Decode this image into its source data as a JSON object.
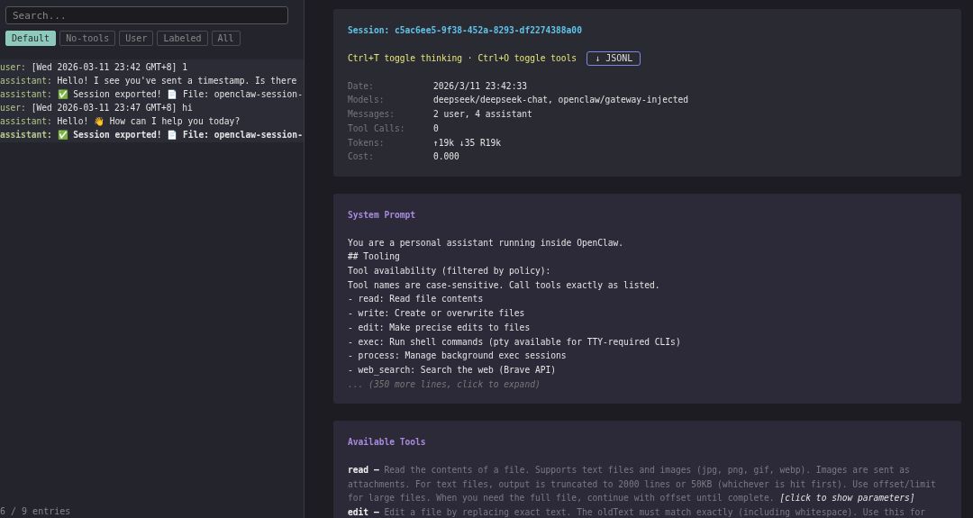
{
  "sidebar": {
    "search": {
      "placeholder": "Search..."
    },
    "filters": [
      {
        "label": "Default",
        "selected": true
      },
      {
        "label": "No-tools",
        "selected": false
      },
      {
        "label": "User",
        "selected": false
      },
      {
        "label": "Labeled",
        "selected": false
      },
      {
        "label": "All",
        "selected": false
      }
    ],
    "entries": [
      {
        "role": "user:",
        "text": "[Wed 2026-03-11 23:42 GMT+8] 1",
        "bold": false
      },
      {
        "role": "assistant:",
        "text": "Hello! I see you've sent a timestamp. Is there",
        "bold": false
      },
      {
        "role": "assistant:",
        "text": "✅ Session exported! 📄 File: openclaw-session-",
        "bold": false
      },
      {
        "role": "user:",
        "text": "[Wed 2026-03-11 23:47 GMT+8] hi",
        "bold": false
      },
      {
        "role": "assistant:",
        "text": "Hello! 👋 How can I help you today?",
        "bold": false
      },
      {
        "role": "assistant:",
        "text": "✅ Session exported! 📄 File: openclaw-session-",
        "bold": true
      }
    ],
    "footer": "6 / 9 entries"
  },
  "header": {
    "title": "Session: c5ac6ee5-9f38-452a-8293-df2274388a00",
    "shortcuts": "Ctrl+T toggle thinking · Ctrl+O toggle tools",
    "download_button": "↓ JSONL",
    "info": [
      {
        "label": "Date:",
        "value": "2026/3/11 23:42:33"
      },
      {
        "label": "Models:",
        "value": "deepseek/deepseek-chat, openclaw/gateway-injected"
      },
      {
        "label": "Messages:",
        "value": "2 user, 4 assistant"
      },
      {
        "label": "Tool Calls:",
        "value": "0"
      },
      {
        "label": "Tokens:",
        "value": "↑19k ↓35 R19k"
      },
      {
        "label": "Cost:",
        "value": "0.000"
      }
    ]
  },
  "system_prompt": {
    "title": "System Prompt",
    "lines": [
      "You are a personal assistant running inside OpenClaw.",
      "## Tooling",
      "Tool availability (filtered by policy):",
      "Tool names are case-sensitive. Call tools exactly as listed.",
      "- read: Read file contents",
      "- write: Create or overwrite files",
      "- edit: Make precise edits to files",
      "- exec: Run shell commands (pty available for TTY-required CLIs)",
      "- process: Manage background exec sessions",
      "- web_search: Search the web (Brave API)"
    ],
    "expand": "... (350 more lines, click to expand)"
  },
  "tools": {
    "title": "Available Tools",
    "items": [
      {
        "name": "read",
        "separator": "–",
        "description": "Read the contents of a file. Supports text files and images (jpg, png, gif, webp). Images are sent as attachments. For text files, output is truncated to 2000 lines or 50KB (whichever is hit first). Use offset/limit for large files. When you need the full file, continue with offset until complete.",
        "hint": "[click to show parameters]"
      },
      {
        "name": "edit",
        "separator": "–",
        "description": "Edit a file by replacing exact text. The oldText must match exactly (including whitespace). Use this for"
      }
    ]
  }
}
